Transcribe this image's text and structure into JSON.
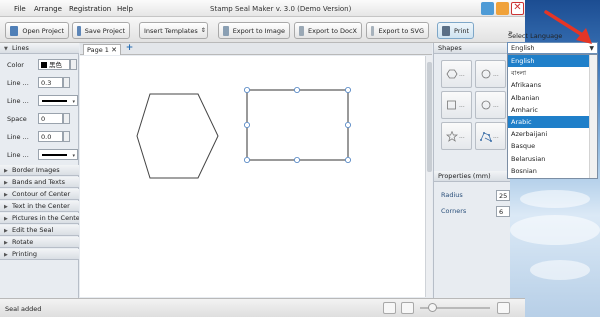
{
  "app": {
    "title": "Stamp Seal Maker v. 3.0 (Demo Version)",
    "menu": [
      "File",
      "Arrange",
      "Registration",
      "Help"
    ]
  },
  "toolbar": {
    "open_project": "Open Project",
    "save_project": "Save Project",
    "insert_templates": "Insert Templates",
    "export_image": "Export to Image",
    "export_docx": "Export to DocX",
    "export_svg": "Export to SVG",
    "print": "Print"
  },
  "left_panel": {
    "lines_header": "Lines",
    "color_label": "Color",
    "color_value": "黑色",
    "line_label_1": "Line ...",
    "line_value_1": "0.3",
    "line_label_2": "Line ...",
    "space_label": "Space",
    "space_value": "0",
    "line_label_3": "Line ...",
    "line_value_3": "0.0",
    "line_label_4": "Line ...",
    "sections": [
      "Border Images",
      "Bands and Texts",
      "Contour of Center",
      "Text in the Center",
      "Pictures in the Center",
      "Edit the Seal",
      "Rotate",
      "Printing"
    ]
  },
  "document": {
    "tab_label": "Page 1",
    "add_tab_symbol": "+"
  },
  "right_panel": {
    "shapes_header": "Shapes",
    "shape_dots": "...",
    "properties_header": "Properties (mm)",
    "radius_label": "Radius",
    "radius_value": "25",
    "corners_label": "Corners",
    "corners_value": "6"
  },
  "status": {
    "message": "Seal added"
  },
  "language": {
    "header": "Select Language",
    "selected": "English",
    "options": [
      "English",
      "বাংলা",
      "Afrikaans",
      "Albanian",
      "Amharic",
      "Arabic",
      "Azerbaijani",
      "Basque",
      "Belarusian",
      "Bosnian"
    ],
    "highlighted_index": 5
  },
  "colors": {
    "accent": "#1f7fc9",
    "arrow": "#e53525"
  }
}
